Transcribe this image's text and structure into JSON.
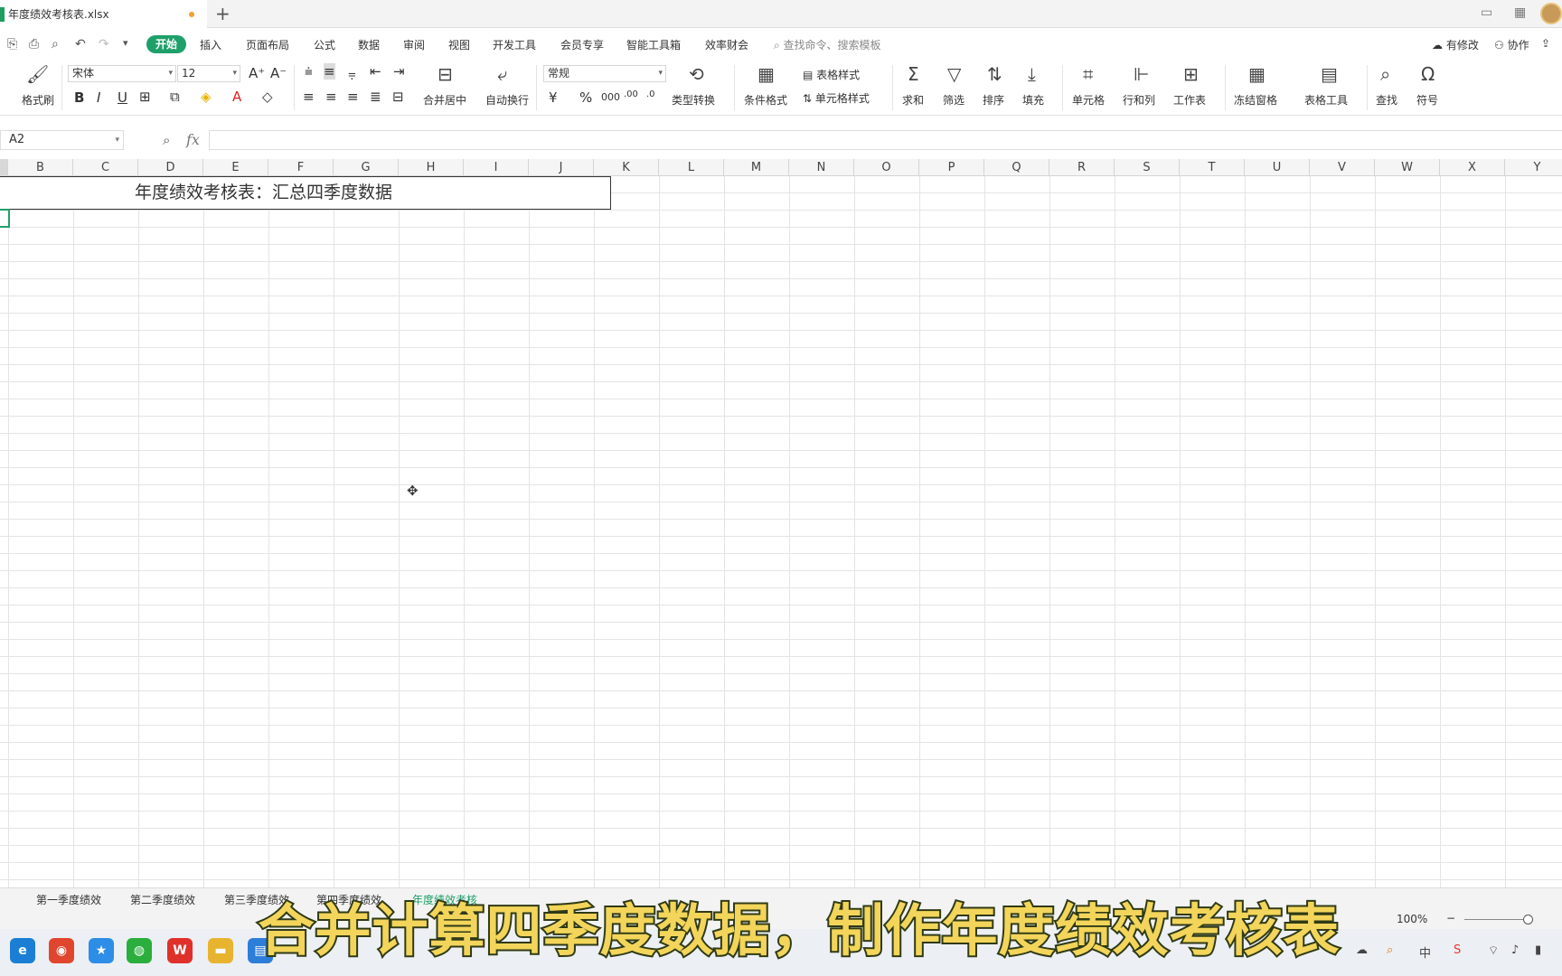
{
  "window": {
    "doc_title": "年度绩效考核表.xlsx"
  },
  "menu": {
    "items": [
      "开始",
      "插入",
      "页面布局",
      "公式",
      "数据",
      "审阅",
      "视图",
      "开发工具",
      "会员专享",
      "智能工具箱",
      "效率财会"
    ],
    "search": "查找命令、搜索模板",
    "modified": "有修改",
    "collab": "协作"
  },
  "ribbon": {
    "format_painter": "格式刷",
    "font_name": "宋体",
    "font_size": "12",
    "merge": "合并居中",
    "wrap": "自动换行",
    "number_format": "常规",
    "type_convert": "类型转换",
    "cond_format": "条件格式",
    "table_style": "表格样式",
    "cell_style": "单元格样式",
    "sum": "求和",
    "filter": "筛选",
    "sort": "排序",
    "fill": "填充",
    "cell": "单元格",
    "row_col": "行和列",
    "sheet": "工作表",
    "freeze": "冻结窗格",
    "table_tools": "表格工具",
    "find": "查找",
    "symbol": "符号"
  },
  "formula_bar": {
    "name_box": "A2",
    "fx": "fx",
    "value": ""
  },
  "columns": [
    "B",
    "C",
    "D",
    "E",
    "F",
    "G",
    "H",
    "I",
    "J",
    "K",
    "L",
    "M",
    "N",
    "O",
    "P",
    "Q",
    "R",
    "S",
    "T",
    "U",
    "V",
    "W",
    "X",
    "Y"
  ],
  "cells": {
    "title": "年度绩效考核表：汇总四季度数据"
  },
  "sheets": [
    "第一季度绩效",
    "第二季度绩效",
    "第三季度绩效",
    "第四季度绩效",
    "年度绩效考核"
  ],
  "status": {
    "zoom": "100%"
  },
  "subtitle": "合并计算四季度数据，制作年度绩效考核表",
  "colors": {
    "accent": "#1fa06a",
    "subtitle_fill": "#f2d55a",
    "subtitle_stroke": "#2f3a16"
  }
}
